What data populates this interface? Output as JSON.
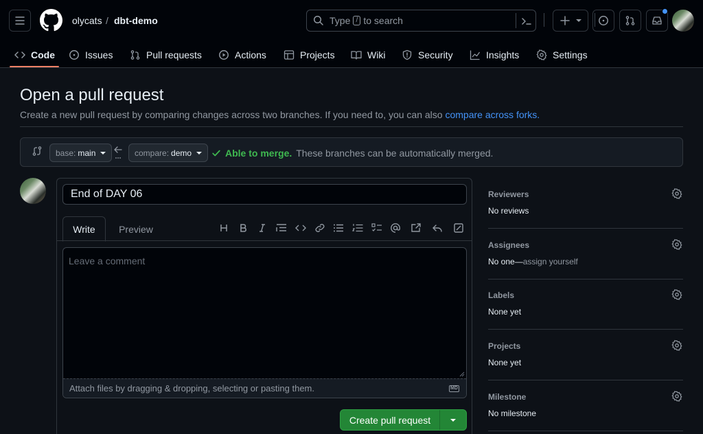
{
  "header": {
    "owner": "olycats",
    "separator": "/",
    "repo": "dbt-demo",
    "search_prefix": "Type",
    "search_key": "/",
    "search_suffix": "to search",
    "notification_dot_color": "#4493f8"
  },
  "nav": {
    "items": [
      {
        "label": "Code",
        "icon": "code-icon",
        "active": true
      },
      {
        "label": "Issues",
        "icon": "issue-icon"
      },
      {
        "label": "Pull requests",
        "icon": "pull-request-icon"
      },
      {
        "label": "Actions",
        "icon": "play-icon"
      },
      {
        "label": "Projects",
        "icon": "table-icon"
      },
      {
        "label": "Wiki",
        "icon": "book-icon"
      },
      {
        "label": "Security",
        "icon": "shield-icon"
      },
      {
        "label": "Insights",
        "icon": "graph-icon"
      },
      {
        "label": "Settings",
        "icon": "gear-icon"
      }
    ]
  },
  "page": {
    "title": "Open a pull request",
    "subtitle": "Create a new pull request by comparing changes across two branches. If you need to, you can also ",
    "subtitle_link": "compare across forks."
  },
  "compare": {
    "base_prefix": "base:",
    "base_value": "main",
    "compare_prefix": "compare:",
    "compare_value": "demo",
    "merge_status": "Able to merge.",
    "merge_message": "These branches can be automatically merged.",
    "merge_color": "#3fb950"
  },
  "form": {
    "title_value": "End of DAY 06",
    "tab_write": "Write",
    "tab_preview": "Preview",
    "comment_placeholder": "Leave a comment",
    "attach_hint": "Attach files by dragging & dropping, selecting or pasting them.",
    "markdown_badge": "MD",
    "create_button": "Create pull request",
    "button_color": "#238636"
  },
  "sidebar": {
    "reviewers": {
      "heading": "Reviewers",
      "value": "No reviews"
    },
    "assignees": {
      "heading": "Assignees",
      "value": "No one—",
      "link": "assign yourself"
    },
    "labels": {
      "heading": "Labels",
      "value": "None yet"
    },
    "projects": {
      "heading": "Projects",
      "value": "None yet"
    },
    "milestone": {
      "heading": "Milestone",
      "value": "No milestone"
    }
  }
}
